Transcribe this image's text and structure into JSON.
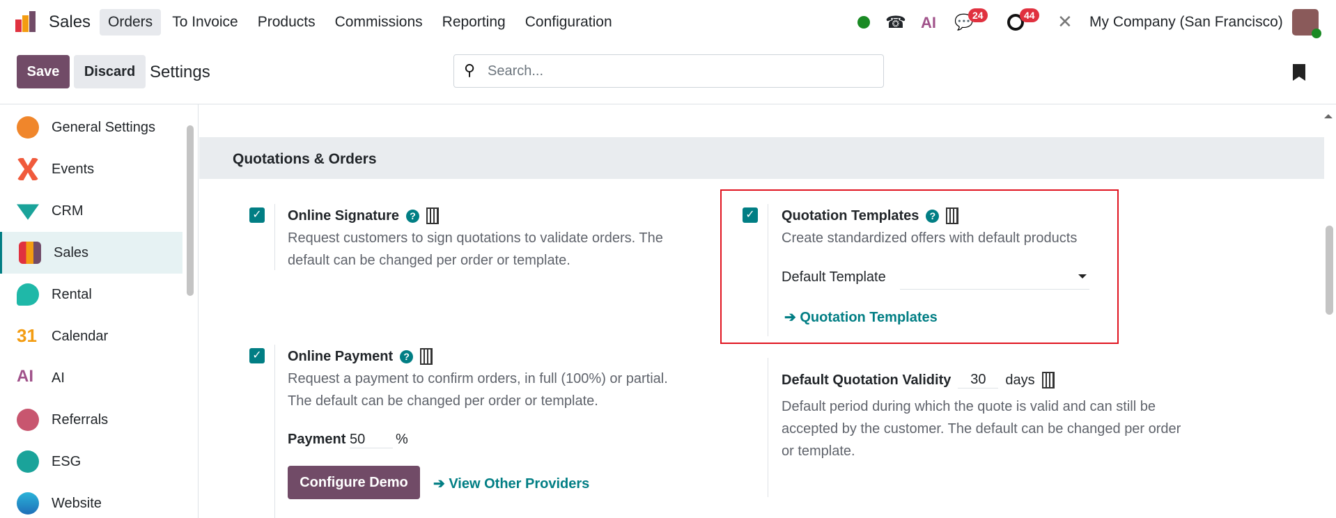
{
  "nav": {
    "app": "Sales",
    "menu": [
      "Orders",
      "To Invoice",
      "Products",
      "Commissions",
      "Reporting",
      "Configuration"
    ],
    "messages_count": "24",
    "activities_count": "44",
    "company": "My Company (San Francisco)",
    "ai_label": "AI"
  },
  "control": {
    "save": "Save",
    "discard": "Discard",
    "title": "Settings",
    "search_placeholder": "Search..."
  },
  "sidebar": [
    "General Settings",
    "Events",
    "CRM",
    "Sales",
    "Rental",
    "Calendar",
    "AI",
    "Referrals",
    "ESG",
    "Website"
  ],
  "section": {
    "title": "Quotations & Orders"
  },
  "settings": {
    "online_signature": {
      "title": "Online Signature",
      "desc1": "Request customers to sign quotations to validate orders. The",
      "desc2": "default can be changed per order or template.",
      "checked": true
    },
    "quotation_templates": {
      "title": "Quotation Templates",
      "desc": "Create standardized offers with default products",
      "field_label": "Default Template",
      "field_value": "",
      "link": "Quotation Templates",
      "checked": true
    },
    "online_payment": {
      "title": "Online Payment",
      "desc1": "Request a payment to confirm orders, in full (100%) or partial.",
      "desc2": "The default can be changed per order or template.",
      "payment_label": "Payment",
      "payment_value": "50",
      "payment_unit": "%",
      "configure": "Configure Demo",
      "providers_link": "View Other Providers",
      "checked": true
    },
    "validity": {
      "title": "Default Quotation Validity",
      "value": "30",
      "unit": "days",
      "desc1": "Default period during which the quote is valid and can still be",
      "desc2": "accepted by the customer. The default can be changed per order",
      "desc3": "or template."
    }
  }
}
